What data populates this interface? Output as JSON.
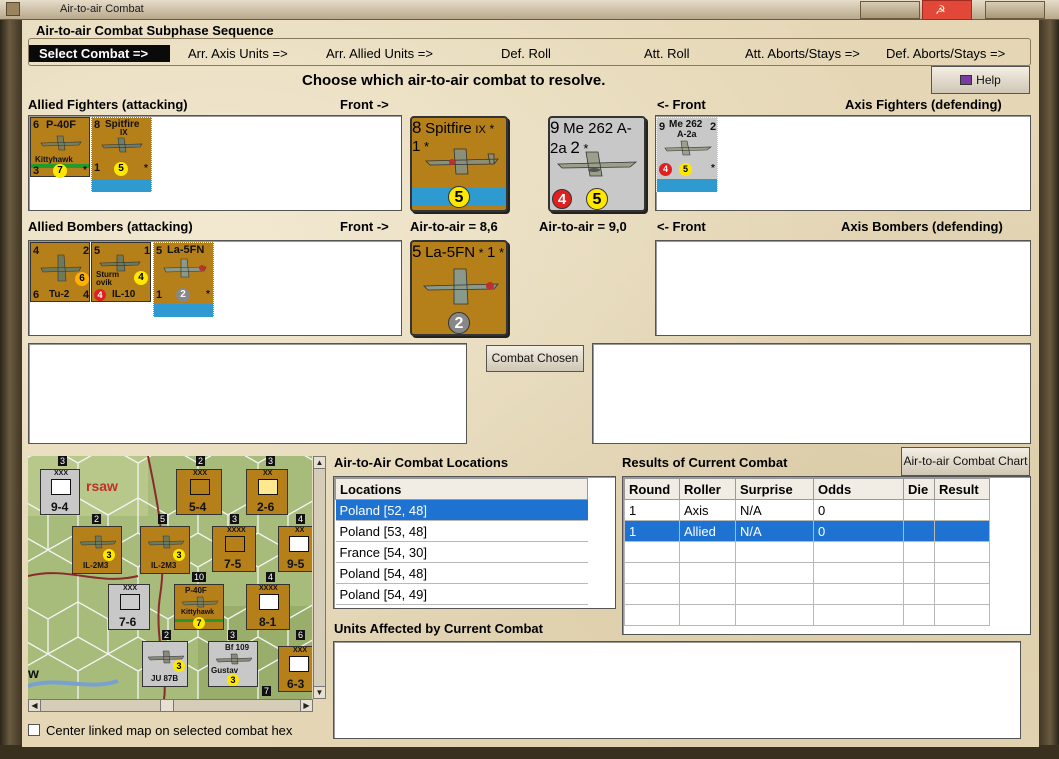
{
  "window": {
    "title": "Air-to-air Combat"
  },
  "sequence": {
    "heading": "Air-to-air Combat Subphase Sequence",
    "current": "Select Combat =>",
    "steps": [
      "Arr. Axis Units =>",
      "Arr. Allied Units =>",
      "Def. Roll",
      "Att. Roll",
      "Att. Aborts/Stays =>",
      "Def. Aborts/Stays =>"
    ]
  },
  "instruction": "Choose which air-to-air combat to resolve.",
  "help_button": "Help",
  "allied_fighters": {
    "label": "Allied Fighters (attacking)",
    "front": "Front ->",
    "counters": [
      {
        "left": "6",
        "name": "P-40F",
        "sub": "Kittyhawk",
        "bottom_left": "3",
        "rating": "7",
        "right": "*"
      },
      {
        "left": "8",
        "name": "Spitfire",
        "sub": "IX",
        "bottom_left": "1",
        "rating": "5",
        "right": "*"
      }
    ]
  },
  "axis_fighters": {
    "label": "Axis Fighters (defending)",
    "front": "<- Front",
    "counters": [
      {
        "left": "9",
        "name": "Me 262",
        "sub": "A-2a",
        "right": "2",
        "attack": "4",
        "rating": "5",
        "star": "*"
      }
    ]
  },
  "allied_bombers": {
    "label": "Allied Bombers (attacking)",
    "front": "Front ->",
    "counters": [
      {
        "left": "4",
        "right": "2",
        "name": "Tu-2",
        "bottom_left": "6",
        "bottom_right": "4",
        "rating": "6"
      },
      {
        "left": "5",
        "right": "1",
        "name": "IL-10",
        "sub": "Sturm ovik",
        "attack": "4",
        "rating": "4"
      },
      {
        "left": "5",
        "name": "La-5FN",
        "bottom_left": "1",
        "rating": "2",
        "right": "*"
      }
    ]
  },
  "axis_bombers": {
    "label": "Axis Bombers (defending)",
    "front": "<- Front"
  },
  "combat": {
    "attacker_top": {
      "left": "8",
      "name": "Spitfire",
      "sub": "IX",
      "right": "*",
      "bottom_left": "1",
      "rating": "5",
      "star": "*"
    },
    "defender_top": {
      "left": "9",
      "name": "Me 262",
      "sub": "A-2a",
      "right": "2",
      "attack": "4",
      "rating": "5",
      "star": "*"
    },
    "attacker_bottom": {
      "left": "5",
      "name": "La-5FN",
      "right": "*",
      "bottom_left": "1",
      "rating": "2",
      "star": "*"
    },
    "attacker_air": "Air-to-air = 8,6",
    "defender_air": "Air-to-air = 9,0",
    "chosen_button": "Combat Chosen"
  },
  "map": {
    "city": "rsaw",
    "city2": "w",
    "units": [
      {
        "top": "XXX",
        "value": "9-4"
      },
      {
        "top": "XXX",
        "value": "5-4"
      },
      {
        "top": "XX",
        "value": "2-6"
      },
      {
        "top": "XXXX",
        "value": "7-5"
      },
      {
        "top": "XX",
        "value": "9-5"
      },
      {
        "top": "XXX",
        "value": "7-6"
      },
      {
        "top": "XXXX",
        "value": "8-1"
      },
      {
        "top": "XX",
        "value": "9-5"
      },
      {
        "top": "XXX",
        "value": "6-3"
      }
    ],
    "air_units": [
      {
        "name": "IL-2M3",
        "rating": "3"
      },
      {
        "name": "IL-2M3",
        "rating": "3"
      },
      {
        "name": "P-40F",
        "sub": "Kittyhawk",
        "rating": "7"
      },
      {
        "name": "JU 87B",
        "rating": "3"
      },
      {
        "name": "Bf 109",
        "sub": "Gustav",
        "rating": "3"
      }
    ],
    "stack_numbers": [
      "3",
      "2",
      "3",
      "2",
      "5",
      "3",
      "4",
      "10",
      "4",
      "2",
      "3",
      "7",
      "6"
    ],
    "center_option": "Center linked map on selected combat hex"
  },
  "locations": {
    "label": "Air-to-Air Combat Locations",
    "column": "Locations",
    "rows": [
      "Poland [52, 48]",
      "Poland [53, 48]",
      "France [54, 30]",
      "Poland [54, 48]",
      "Poland [54, 49]"
    ],
    "selected": 0
  },
  "results": {
    "label": "Results of Current Combat",
    "chart_button": "Air-to-air Combat Chart",
    "columns": [
      "Round",
      "Roller",
      "Surprise",
      "Odds",
      "Die",
      "Result"
    ],
    "rows": [
      [
        "1",
        "Axis",
        "N/A",
        "0",
        "",
        ""
      ],
      [
        "1",
        "Allied",
        "N/A",
        "0",
        "",
        ""
      ]
    ],
    "selected": 1
  },
  "units_affected": {
    "label": "Units Affected by Current Combat"
  },
  "colors": {
    "parchment": "#e5d7b6",
    "counter_tan": "#b57f1a",
    "counter_grey": "#c8c8c8",
    "selection": "#1e72d2",
    "rating_yellow": "#ffe800",
    "rating_red": "#e02020",
    "band_blue": "#2e9ad0"
  }
}
